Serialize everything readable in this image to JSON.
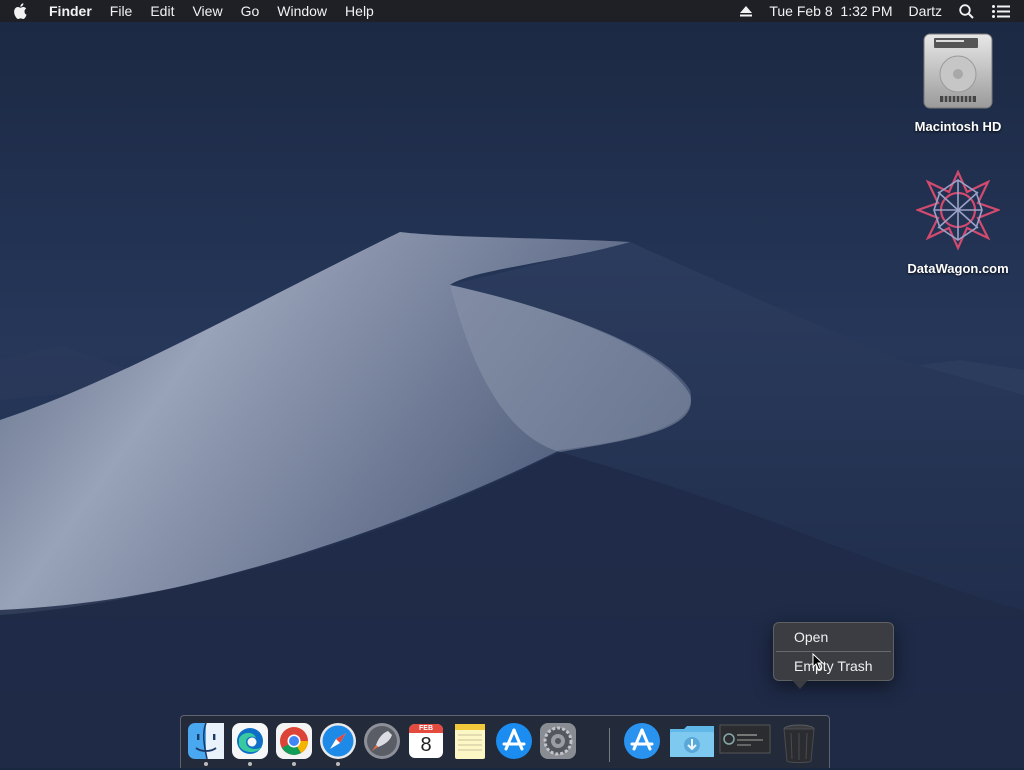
{
  "menubar": {
    "app_name": "Finder",
    "menus": [
      "File",
      "Edit",
      "View",
      "Go",
      "Window",
      "Help"
    ],
    "datetime": "Tue Feb 8  1:32 PM",
    "user": "Dartz"
  },
  "desktop": {
    "icons": [
      {
        "label": "Macintosh HD",
        "icon": "hard-drive-icon"
      },
      {
        "label": "DataWagon.com",
        "icon": "datawagon-icon"
      }
    ]
  },
  "context_menu": {
    "items": [
      "Open",
      "Empty Trash"
    ]
  },
  "dock": {
    "calendar_month": "FEB",
    "calendar_day": "8",
    "apps": [
      {
        "name": "finder-icon",
        "running": true
      },
      {
        "name": "edge-icon",
        "running": true
      },
      {
        "name": "chrome-icon",
        "running": true
      },
      {
        "name": "safari-icon",
        "running": true
      },
      {
        "name": "launchpad-icon",
        "running": false
      },
      {
        "name": "calendar-icon",
        "running": false
      },
      {
        "name": "notes-icon",
        "running": false
      },
      {
        "name": "app-store-icon",
        "running": false
      },
      {
        "name": "system-preferences-icon",
        "running": false
      },
      {
        "name": "applications-folder-icon",
        "running": false
      },
      {
        "name": "downloads-folder-icon",
        "running": false
      },
      {
        "name": "screenshot-thumbnail-icon",
        "running": false
      },
      {
        "name": "trash-icon",
        "running": false
      }
    ]
  },
  "colors": {
    "menubar_bg": "#1e2024",
    "sky": "#22324f",
    "dune": "#8a93a8"
  }
}
